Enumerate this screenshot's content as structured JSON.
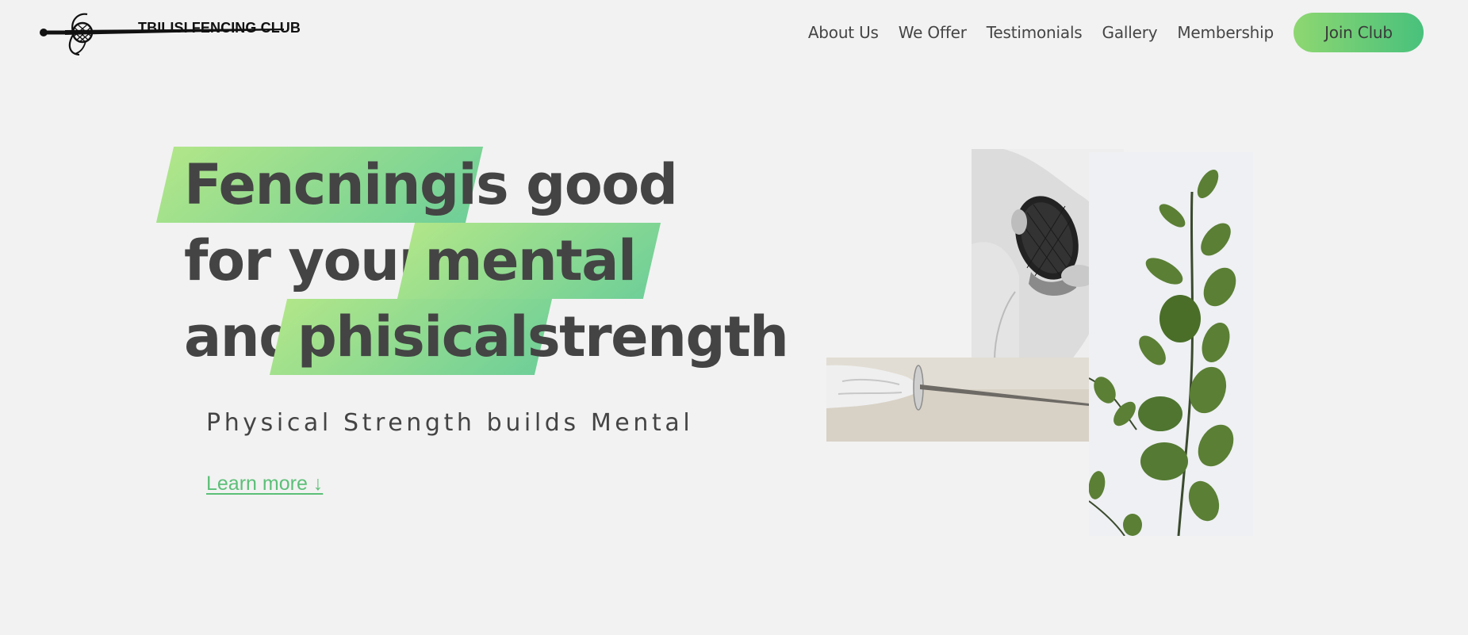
{
  "header": {
    "logo_text": "TBILISI FENCING CLUB",
    "nav": [
      {
        "label": "About Us"
      },
      {
        "label": "We Offer"
      },
      {
        "label": "Testimonials"
      },
      {
        "label": "Gallery"
      },
      {
        "label": "Membership"
      }
    ],
    "join_label": "Join Club"
  },
  "hero": {
    "line1": {
      "highlight": "Fencning",
      "rest": " is good"
    },
    "line2": {
      "lead": "for your ",
      "highlight": "mental"
    },
    "line3": {
      "lead": "and ",
      "highlight": "phisical",
      "rest": " strength"
    },
    "subtitle": "Physical Strength builds Mental",
    "learn_more": "Learn more ↓"
  },
  "colors": {
    "accent_start": "#b1e689",
    "accent_end": "#48c17c",
    "text": "#444444",
    "background": "#f2f2f2",
    "link": "#5cbf78"
  },
  "images": {
    "mask": "fencer-holding-mask-photo",
    "blade": "gloved-hand-holding-sword-photo",
    "plant": "eucalyptus-branch-photo"
  }
}
